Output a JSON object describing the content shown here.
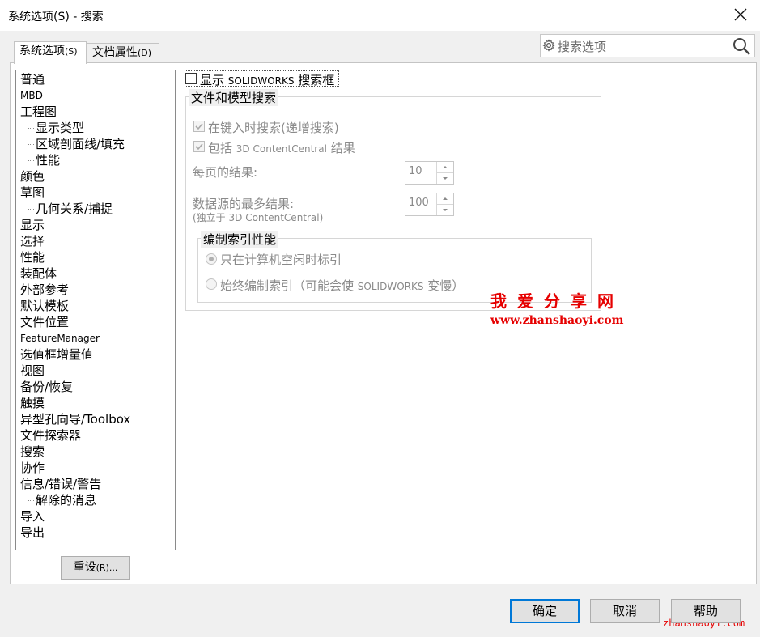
{
  "window": {
    "title": "系统选项(S) - 搜索",
    "close_icon": "close-icon"
  },
  "tabs": [
    {
      "label": "系统选项",
      "suffix": "(S)",
      "active": true
    },
    {
      "label": "文档属性",
      "suffix": "(D)",
      "active": false
    }
  ],
  "search": {
    "placeholder": "搜索选项",
    "icon": "gear-icon",
    "button_icon": "magnifier-icon"
  },
  "tree": {
    "items": [
      {
        "label": "普通",
        "level": 0
      },
      {
        "label": "MBD",
        "level": 0,
        "small": true
      },
      {
        "label": "工程图",
        "level": 0
      },
      {
        "label": "显示类型",
        "level": 1
      },
      {
        "label": "区域剖面线/填充",
        "level": 1
      },
      {
        "label": "性能",
        "level": 1
      },
      {
        "label": "颜色",
        "level": 0
      },
      {
        "label": "草图",
        "level": 0
      },
      {
        "label": "几何关系/捕捉",
        "level": 1
      },
      {
        "label": "显示",
        "level": 0
      },
      {
        "label": "选择",
        "level": 0
      },
      {
        "label": "性能",
        "level": 0
      },
      {
        "label": "装配体",
        "level": 0
      },
      {
        "label": "外部参考",
        "level": 0
      },
      {
        "label": "默认模板",
        "level": 0
      },
      {
        "label": "文件位置",
        "level": 0
      },
      {
        "label": "FeatureManager",
        "level": 0,
        "small": true
      },
      {
        "label": "选值框增量值",
        "level": 0
      },
      {
        "label": "视图",
        "level": 0
      },
      {
        "label": "备份/恢复",
        "level": 0
      },
      {
        "label": "触摸",
        "level": 0
      },
      {
        "label": "异型孔向导/Toolbox",
        "level": 0
      },
      {
        "label": "文件探索器",
        "level": 0
      },
      {
        "label": "搜索",
        "level": 0,
        "selected": true
      },
      {
        "label": "协作",
        "level": 0
      },
      {
        "label": "信息/错误/警告",
        "level": 0
      },
      {
        "label": "解除的消息",
        "level": 1
      },
      {
        "label": "导入",
        "level": 0
      },
      {
        "label": "导出",
        "level": 0
      }
    ]
  },
  "reset_button": {
    "label": "重设",
    "suffix": "(R)..."
  },
  "options": {
    "show_search_box": {
      "prefix": "显示",
      "product": "SOLIDWORKS",
      "suffix": "搜索框",
      "checked": false
    },
    "file_model_group": {
      "title": "文件和模型搜索",
      "incremental": {
        "label": "在键入时搜索(递增搜索)",
        "checked": true,
        "enabled": false
      },
      "include_cc": {
        "prefix": "包括",
        "mid": "3D ContentCentral",
        "suffix": "结果",
        "checked": true,
        "enabled": false
      },
      "results_per_page": {
        "label": "每页的结果:",
        "value": "10"
      },
      "max_results": {
        "label": "数据源的最多结果:",
        "sub_prefix": "(独立于",
        "sub_mid": "3D ContentCentral)",
        "value": "100"
      },
      "index_group": {
        "title": "编制索引性能",
        "idle_only": {
          "label": "只在计算机空闲时标引",
          "selected": true
        },
        "always": {
          "prefix": "始终编制索引（可能会使",
          "product": "SOLIDWORKS",
          "suffix": "变慢）",
          "selected": false
        }
      }
    }
  },
  "watermark": {
    "title": "我爱分享网",
    "url": "www.zhanshaoyi.com",
    "corner": "zhanshaoyi.com",
    "color": "#e60000"
  },
  "footer": {
    "ok": "确定",
    "cancel": "取消",
    "help": "帮助"
  },
  "colors": {
    "accent": "#0078d7",
    "dialog_bg": "#f0f0f0"
  }
}
